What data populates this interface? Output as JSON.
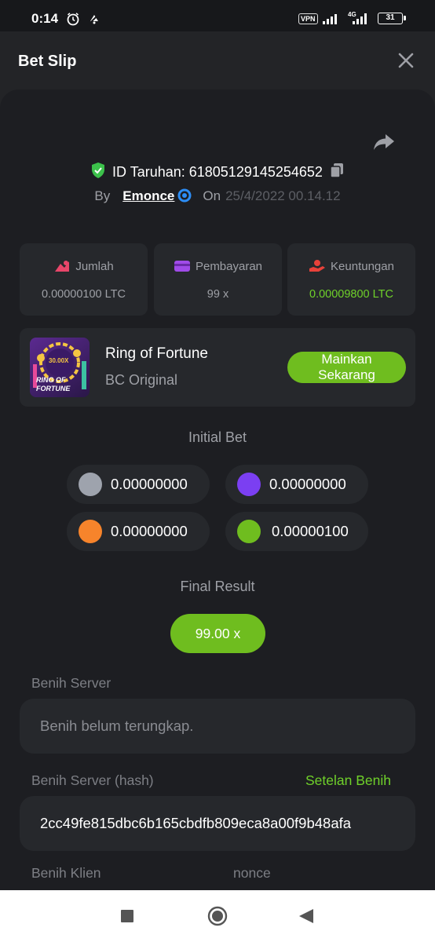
{
  "status_bar": {
    "time": "0:14",
    "vpn_label": "VPN",
    "network_label": "4G",
    "battery": "31"
  },
  "header": {
    "title": "Bet Slip"
  },
  "bet": {
    "id_label": "ID Taruhan: 61805129145254652",
    "by_label": "By",
    "user": "Emonce",
    "on_label": "On",
    "date": "25/4/2022 00.14.12"
  },
  "stats": [
    {
      "label": "Jumlah",
      "value": "0.00000100 LTC",
      "icon": "bet-amount-icon"
    },
    {
      "label": "Pembayaran",
      "value": "99 x",
      "icon": "card-icon"
    },
    {
      "label": "Keuntungan",
      "value": "0.00009800 LTC",
      "icon": "profit-hand-icon",
      "value_color": "#6fd12a"
    }
  ],
  "game": {
    "name": "Ring of Fortune",
    "provider": "BC Original",
    "play_label_1": "Mainkan",
    "play_label_2": "Sekarang",
    "thumb_multiplier": "30.00X",
    "thumb_line_1": "RING OF",
    "thumb_line_2": "FORTUNE"
  },
  "initial_bet": {
    "title": "Initial Bet",
    "chips": [
      {
        "color": "#9ea3ad",
        "amount": "0.00000000"
      },
      {
        "color": "#7b3ff2",
        "amount": "0.00000000"
      },
      {
        "color": "#f7842b",
        "amount": "0.00000000"
      },
      {
        "color": "#6fbd1f",
        "amount": "0.00000100"
      }
    ]
  },
  "final_result": {
    "title": "Final Result",
    "value": "99.00 x"
  },
  "server_seed": {
    "label": "Benih Server",
    "placeholder": "Benih belum terungkap."
  },
  "server_hash": {
    "label": "Benih Server (hash)",
    "settings_link": "Setelan Benih",
    "value": "2cc49fe815dbc6b165cbdfb809eca8a00f9b48afa"
  },
  "client": {
    "seed_label": "Benih Klien",
    "nonce_label": "nonce"
  },
  "colors": {
    "accent_green": "#6fbd1f",
    "profit_green": "#6fd12a",
    "background": "#1d1e22",
    "card": "#26282c"
  }
}
